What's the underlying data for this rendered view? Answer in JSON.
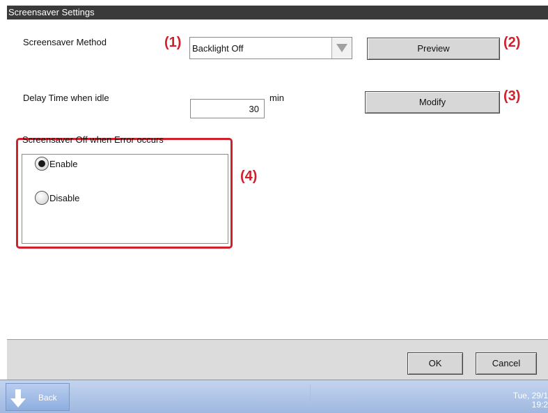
{
  "window": {
    "title": "Screensaver Settings"
  },
  "method": {
    "label": "Screensaver Method",
    "value": "Backlight Off",
    "annotation": "(1)"
  },
  "preview": {
    "label": "Preview",
    "annotation": "(2)"
  },
  "delay": {
    "label": "Delay Time when idle",
    "value": "30",
    "unit": "min"
  },
  "modify": {
    "label": "Modify",
    "annotation": "(3)"
  },
  "error_group": {
    "title": "Screensaver Off when Error occurs",
    "annotation": "(4)",
    "options": [
      {
        "label": "Enable",
        "selected": true
      },
      {
        "label": "Disable",
        "selected": false
      }
    ]
  },
  "footer": {
    "ok_label": "OK",
    "cancel_label": "Cancel"
  },
  "taskbar": {
    "back_label": "Back",
    "date_line1": "Tue, 29/1",
    "date_line2": "19:2"
  },
  "colors": {
    "annotation": "#d0202c",
    "titlebar": "#3a3a3a",
    "taskbar": "#aec3e6"
  }
}
